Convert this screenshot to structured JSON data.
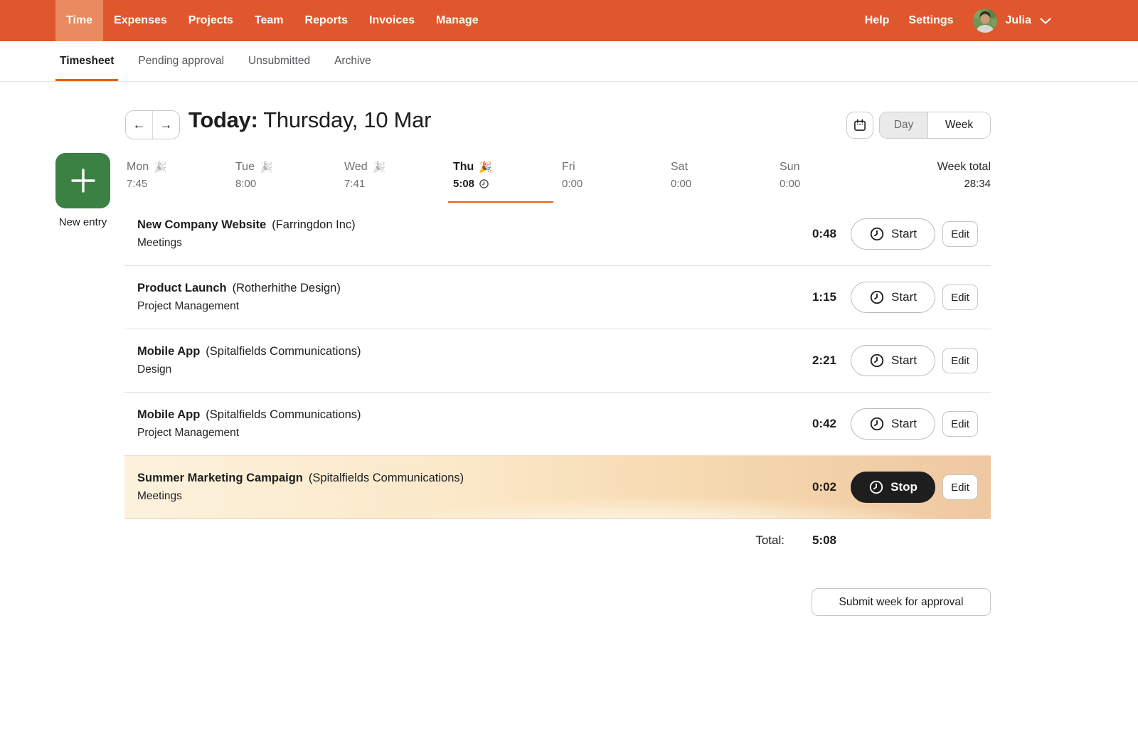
{
  "nav": {
    "items": [
      {
        "label": "Time",
        "active": true
      },
      {
        "label": "Expenses"
      },
      {
        "label": "Projects"
      },
      {
        "label": "Team"
      },
      {
        "label": "Reports"
      },
      {
        "label": "Invoices"
      },
      {
        "label": "Manage"
      }
    ],
    "help_label": "Help",
    "settings_label": "Settings",
    "user_name": "Julia"
  },
  "tabs": [
    {
      "label": "Timesheet",
      "active": true
    },
    {
      "label": "Pending approval"
    },
    {
      "label": "Unsubmitted"
    },
    {
      "label": "Archive"
    }
  ],
  "date_header": {
    "prev_arrow": "←",
    "next_arrow": "→",
    "today_label": "Today:",
    "date_text": " Thursday, 10 Mar",
    "day_view_label": "Day",
    "week_view_label": "Week"
  },
  "new_entry": {
    "plus_glyph": "+",
    "label": "New entry"
  },
  "week": {
    "days": [
      {
        "name": "Mon",
        "emoji": "🎉",
        "time": "7:45"
      },
      {
        "name": "Tue",
        "emoji": "🎉",
        "time": "8:00"
      },
      {
        "name": "Wed",
        "emoji": "🎉",
        "time": "7:41"
      },
      {
        "name": "Thu",
        "emoji": "🎉",
        "time": "5:08",
        "active": true,
        "running": true
      },
      {
        "name": "Fri",
        "time": "0:00"
      },
      {
        "name": "Sat",
        "time": "0:00"
      },
      {
        "name": "Sun",
        "time": "0:00"
      }
    ],
    "total_label": "Week total",
    "total_value": "28:34"
  },
  "entries": [
    {
      "project": "New Company Website",
      "client": "(Farringdon Inc)",
      "task": "Meetings",
      "time": "0:48",
      "action_label": "Start",
      "edit_label": "Edit"
    },
    {
      "project": "Product Launch",
      "client": "(Rotherhithe Design)",
      "task": "Project Management",
      "time": "1:15",
      "action_label": "Start",
      "edit_label": "Edit"
    },
    {
      "project": "Mobile App",
      "client": "(Spitalfields Communications)",
      "task": "Design",
      "time": "2:21",
      "action_label": "Start",
      "edit_label": "Edit"
    },
    {
      "project": "Mobile App",
      "client": "(Spitalfields Communications)",
      "task": "Project Management",
      "time": "0:42",
      "action_label": "Start",
      "edit_label": "Edit"
    },
    {
      "project": "Summer Marketing Campaign",
      "client": "(Spitalfields Communications)",
      "task": "Meetings",
      "time": "0:02",
      "action_label": "Stop",
      "edit_label": "Edit",
      "running": true
    }
  ],
  "footer": {
    "total_label": "Total:",
    "total_value": "5:08",
    "submit_label": "Submit week for approval"
  },
  "colors": {
    "nav_orange": "#e0572e",
    "nav_active_orange": "#e98b5f",
    "accent_orange": "#ec5e0f",
    "new_entry_green": "#3a8143",
    "stop_black": "#1e1e1e",
    "running_row_gradient_left": "#fcf2dd",
    "running_row_gradient_right": "#eec8a1"
  }
}
